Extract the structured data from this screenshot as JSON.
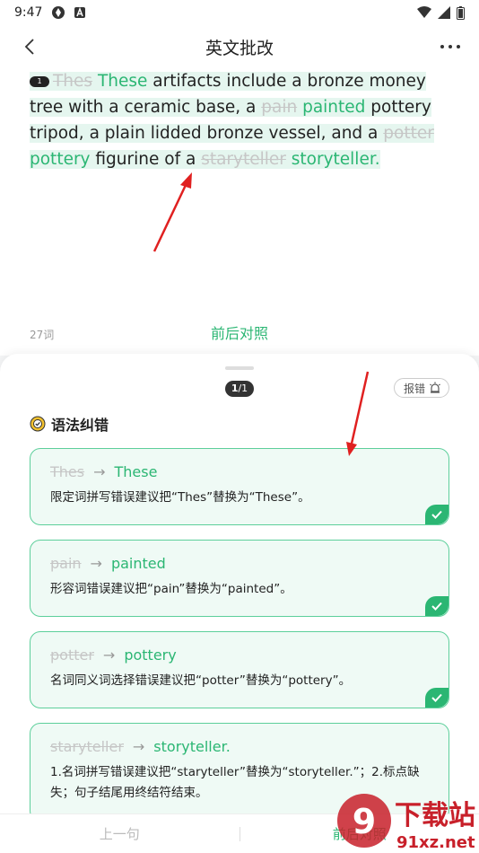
{
  "status": {
    "time": "9:47"
  },
  "header": {
    "title": "英文批改"
  },
  "essay": {
    "badge": "1",
    "seg1_del": "Thes",
    "seg1_ins": "These",
    "seg2": " artifacts include a bronze money tree with a ceramic base, a ",
    "seg3_del": "pain",
    "seg3_ins": "painted",
    "seg4": " pottery tripod, a plain lidded bronze vessel, and a ",
    "seg5_del": "potter",
    "seg5_ins": "pottery",
    "seg6": " figurine of a ",
    "seg7_del": "staryteller",
    "seg7_ins": "storyteller."
  },
  "word_count": "27词",
  "compare_link": "前后对照",
  "sheet": {
    "pager_current": "1",
    "pager_total": "/1",
    "report_label": "报错",
    "section_title": "语法纠错"
  },
  "cards": [
    {
      "from": "Thes",
      "to": "These",
      "desc": "限定词拼写错误建议把“Thes”替换为“These”。"
    },
    {
      "from": "pain",
      "to": "painted",
      "desc": "形容词错误建议把“pain”替换为“painted”。"
    },
    {
      "from": "potter",
      "to": "pottery",
      "desc": "名词同义词选择错误建议把“potter”替换为“pottery”。"
    },
    {
      "from": "staryteller",
      "to": "storyteller.",
      "desc": "1.名词拼写错误建议把“staryteller”替换为“storyteller.”；2.标点缺失；句子结尾用终结符结束。"
    }
  ],
  "bottom": {
    "prev": "上一句",
    "next": "前后对照"
  },
  "colors": {
    "accent": "#2bb673",
    "card_border": "#5dcf9b",
    "card_bg": "#effaf5"
  },
  "watermark": {
    "text": "9下载站",
    "url": "91xz.net"
  }
}
